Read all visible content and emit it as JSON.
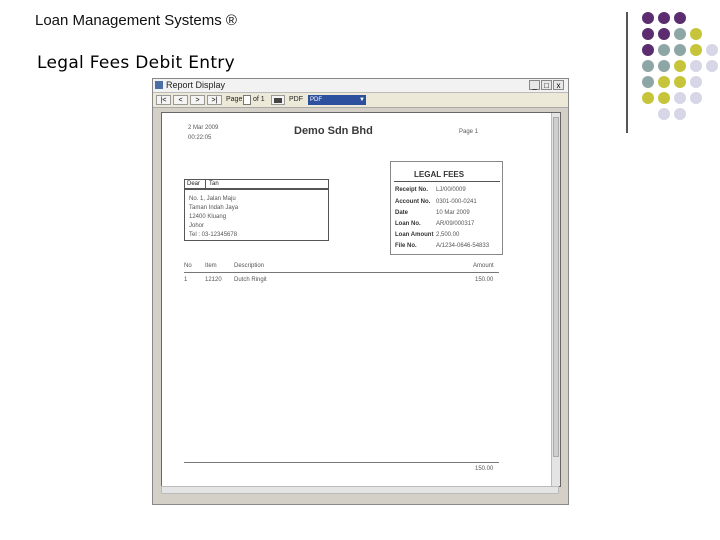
{
  "slide": {
    "header": "Loan Management Systems ®",
    "title": "Legal Fees Debit Entry"
  },
  "decor_colors": {
    "purple": "#5b2d6e",
    "teal": "#8fa6a6",
    "olive": "#c5c43a",
    "lavender": "#d6d6e6"
  },
  "window": {
    "title": "Report Display",
    "btn_minimize": "_",
    "btn_maximize": "□",
    "btn_close": "x",
    "toolbar": {
      "first": "|<",
      "prev": "<",
      "next": ">",
      "last": ">|",
      "page_label": "Page",
      "page_value": "",
      "of_label": "of 1",
      "print": "PDF",
      "format_select": "PDF"
    }
  },
  "report": {
    "date": "2 Mar 2009",
    "time": "00:22:05",
    "company": "Demo Sdn Bhd",
    "page": "Page 1",
    "dear_label": "Dear",
    "dear_value": "Tan",
    "address": [
      "No. 1, Jalan Maju",
      "Taman Indah Jaya",
      "12400  Kluang",
      "Johor",
      "Tel :  03-12345678"
    ],
    "legal_title": "LEGAL FEES",
    "fields": [
      {
        "label": "Receipt No.",
        "value": "LJ/00/0009"
      },
      {
        "label": "Account No.",
        "value": "0301-000-0241"
      },
      {
        "label": "Date",
        "value": "10 Mar 2009"
      },
      {
        "label": "Loan No.",
        "value": "AR/09/000317"
      },
      {
        "label": "Loan Amount",
        "value": "2,500.00"
      },
      {
        "label": "File No.",
        "value": "A/1234-0646-54833"
      }
    ],
    "columns": [
      "No",
      "Item",
      "Description",
      "Amount"
    ],
    "rows": [
      {
        "no": "1",
        "item": "12120",
        "description": "Dutch Ringit",
        "amount": "150.00"
      }
    ],
    "total": "150.00"
  }
}
